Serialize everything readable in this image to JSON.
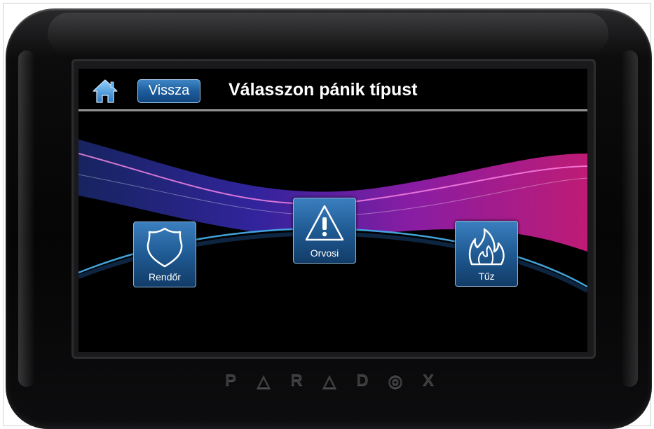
{
  "header": {
    "home_icon": "home-icon",
    "back_label": "Vissza",
    "title": "Válasszon pánik típust"
  },
  "tiles": [
    {
      "label": "Rendőr",
      "icon": "shield-icon"
    },
    {
      "label": "Orvosi",
      "icon": "warning-icon"
    },
    {
      "label": "Tűz",
      "icon": "flame-icon"
    }
  ],
  "brand": {
    "letters": [
      "P",
      "△",
      "R",
      "△",
      "D",
      "◎",
      "X"
    ]
  },
  "colors": {
    "button_blue": "#1d5d9c",
    "background_wave_magenta": "#d0208a",
    "background_wave_purple": "#5a2ad0",
    "horizon_cyan": "#39a8e8"
  }
}
